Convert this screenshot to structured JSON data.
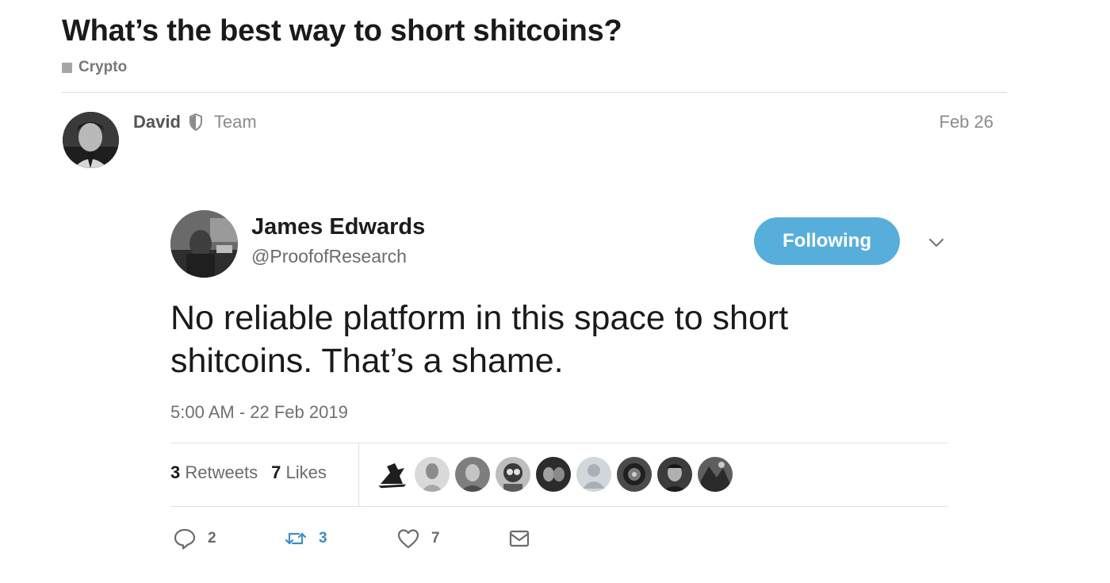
{
  "topic": {
    "title": "What’s the best way to short shitcoins?",
    "category": "Crypto",
    "category_color": "#a6a6a6"
  },
  "post": {
    "author": "David",
    "group": "Team",
    "date": "Feb 26"
  },
  "tweet": {
    "name": "James Edwards",
    "handle": "@ProofofResearch",
    "follow_label": "Following",
    "follow_color": "#58aedb",
    "text": "No reliable platform in this space to short shitcoins. That’s a shame.",
    "timestamp": "5:00 AM - 22 Feb 2019",
    "retweets_count": "3",
    "retweets_label": "Retweets",
    "likes_count": "7",
    "likes_label": "Likes",
    "likers": [
      "liker-1",
      "liker-2",
      "liker-3",
      "liker-4",
      "liker-5",
      "liker-6",
      "liker-7",
      "liker-8",
      "liker-9"
    ],
    "actions": {
      "reply_count": "2",
      "retweet_count": "3",
      "like_count": "7"
    }
  }
}
